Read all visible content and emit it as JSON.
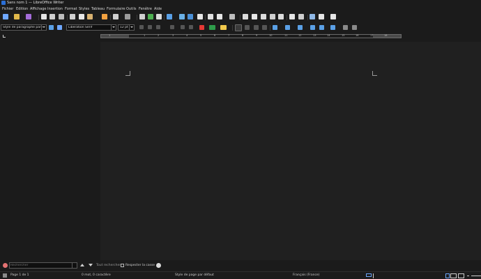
{
  "window": {
    "title": "Sans nom 1 — LibreOffice Writer"
  },
  "menu": [
    "Fichier",
    "Edition",
    "Affichage",
    "Insertion",
    "Format",
    "Styles",
    "Tableau",
    "Formulaire",
    "Outils",
    "Fenêtre",
    "Aide"
  ],
  "formatting": {
    "paragraph_style": "Style de paragraphe par défaut",
    "font_name": "Liberation Serif",
    "font_size": "12 pt"
  },
  "ruler": {
    "labels": [
      "1",
      "1",
      "2",
      "3",
      "4",
      "5",
      "6",
      "7",
      "8",
      "9",
      "10",
      "11",
      "12",
      "13",
      "14",
      "15",
      "16",
      "17",
      "18"
    ]
  },
  "find": {
    "placeholder": "Rechercher",
    "search_button": "Tout rechercher",
    "match_case": "Respecter la casse"
  },
  "status": {
    "page": "Page 1 de 1",
    "words": "0 mot, 0 caractère",
    "page_style": "Style de page par défaut",
    "language": "Français (France)"
  },
  "colors": {
    "accent": "#2b6fd6",
    "font_color": "#e53935",
    "highlight": "#f2c94c",
    "underline_green": "#2e9c4a"
  }
}
